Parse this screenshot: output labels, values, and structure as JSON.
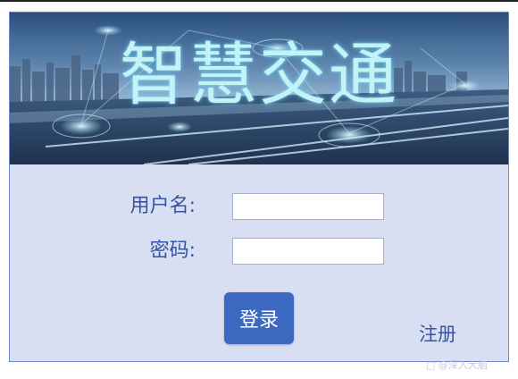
{
  "banner": {
    "title": "智慧交通"
  },
  "form": {
    "username_label": "用户名:",
    "username_value": "",
    "password_label": "密码:",
    "password_value": ""
  },
  "actions": {
    "login_label": "登录",
    "register_label": "注册"
  },
  "watermark": {
    "text": "@深入大脑"
  },
  "colors": {
    "panel_background": "#d8dff2",
    "panel_border": "#6f86c9",
    "label_text": "#3953a3",
    "button_background": "#3c68c0",
    "banner_title": "#c3f2f7"
  },
  "icons": [
    "city-traffic-banner-image",
    "watermark-icon"
  ]
}
